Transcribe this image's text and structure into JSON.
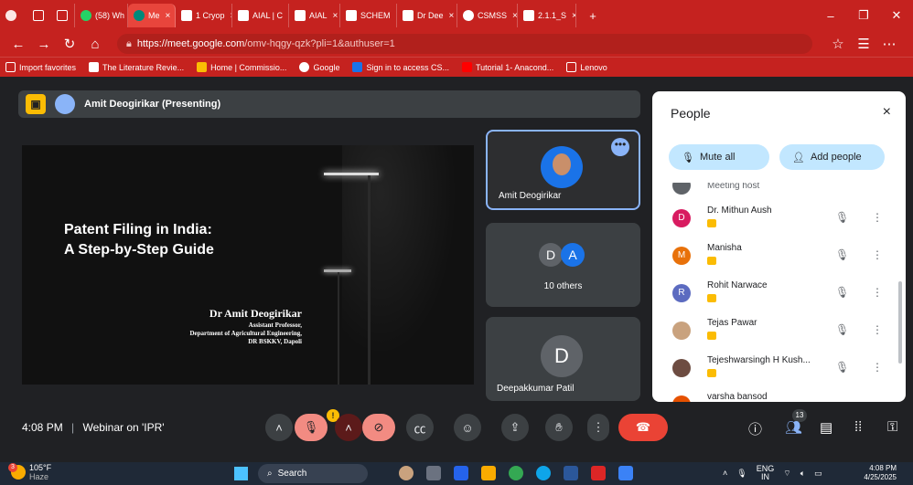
{
  "browser": {
    "tabs": [
      {
        "label": "(58) Wh",
        "color": "#25d366"
      },
      {
        "label": "Me",
        "color": "#00897b",
        "active": true
      },
      {
        "label": "1 Cryop",
        "color": "#ffffff"
      },
      {
        "label": "AIAL | C",
        "color": "#ffffff"
      },
      {
        "label": "AIAL",
        "color": "#ffffff"
      },
      {
        "label": "SCHEM",
        "color": "#ffffff"
      },
      {
        "label": "Dr Dee",
        "color": "#ffffff"
      },
      {
        "label": "CSMSS",
        "color": "#ffffff"
      },
      {
        "label": "2.1.1_S",
        "color": "#ffffff"
      }
    ],
    "url_domain": "https://meet.google.com",
    "url_path": "/omv-hqgy-qzk?pli=1&authuser=1",
    "bookmarks": [
      "Import favorites",
      "The Literature Revie...",
      "Home | Commissio...",
      "Google",
      "Sign in to access CS...",
      "Tutorial 1- Anacond...",
      "Lenovo"
    ]
  },
  "meet": {
    "presenter_label": "Amit Deogirikar (Presenting)",
    "slide": {
      "title_line1": "Patent Filing in India:",
      "title_line2": "A Step-by-Step Guide",
      "author": "Dr Amit Deogirikar",
      "role": "Assistant Professor,",
      "dept": "Department of Agricultural Engineering,",
      "inst": "DR BSKKV, Dapoli"
    },
    "tiles": {
      "speaker_name": "Amit Deogirikar",
      "others_initial1": "D",
      "others_initial2": "A",
      "others_count": "10 others",
      "third_initial": "D",
      "third_name": "Deepakkumar Patil"
    },
    "people": {
      "title": "People",
      "close_icon": "×",
      "mute_all_label": "Mute all",
      "add_people_label": "Add people",
      "partial_top": "Meeting host",
      "rows": [
        {
          "name": "Dr. Mithun Aush",
          "initial": "D",
          "color": "#d81b60"
        },
        {
          "name": "Manisha",
          "initial": "M",
          "color": "#e8710a"
        },
        {
          "name": "Rohit Narwace",
          "initial": "R",
          "color": "#5c6bc0"
        },
        {
          "name": "Tejas Pawar",
          "initial": "",
          "color": "#c9a27e"
        },
        {
          "name": "Tejeshwarsingh H Kush...",
          "initial": "",
          "color": "#6d4c41"
        },
        {
          "name": "varsha bansod",
          "initial": "",
          "color": "#e65100"
        }
      ]
    },
    "controls": {
      "time": "4:08 PM",
      "meeting_name": "Webinar on 'IPR'",
      "mic_badge": "!",
      "participants_count": "13"
    }
  },
  "taskbar": {
    "temp": "105°F",
    "weather": "Haze",
    "weather_badge": "3",
    "search_label": "Search",
    "lang_line1": "ENG",
    "lang_line2": "IN",
    "clock_time": "4:08 PM",
    "clock_date": "4/25/2025"
  }
}
